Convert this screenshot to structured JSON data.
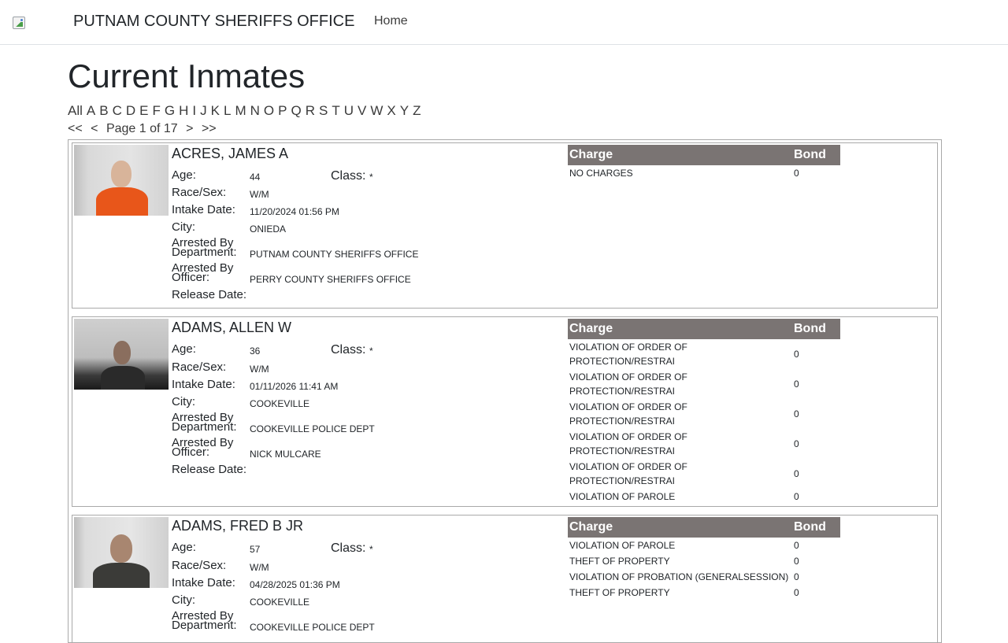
{
  "header": {
    "brand": "PUTNAM COUNTY SHERIFFS OFFICE",
    "home_label": "Home"
  },
  "page": {
    "title": "Current Inmates",
    "letters": [
      "All",
      "A",
      "B",
      "C",
      "D",
      "E",
      "F",
      "G",
      "H",
      "I",
      "J",
      "K",
      "L",
      "M",
      "N",
      "O",
      "P",
      "Q",
      "R",
      "S",
      "T",
      "U",
      "V",
      "W",
      "X",
      "Y",
      "Z"
    ],
    "pager": {
      "first": "<<",
      "prev": "<",
      "label": "Page 1 of 17",
      "next": ">",
      "last": ">>"
    }
  },
  "labels": {
    "age": "Age:",
    "class": "Class:",
    "race_sex": "Race/Sex:",
    "intake": "Intake Date:",
    "city": "City:",
    "dept_1": "Arrested By",
    "dept_2": "Department:",
    "officer_1": "Arrested By",
    "officer_2": "Officer:",
    "release": "Release Date:",
    "charge_header": "Charge",
    "bond_header": "Bond"
  },
  "inmates": [
    {
      "name": "ACRES, JAMES A",
      "age": "44",
      "class": "*",
      "race_sex": "W/M",
      "intake": "11/20/2024 01:56 PM",
      "city": "ONIEDA",
      "department": "PUTNAM COUNTY SHERIFFS OFFICE",
      "officer": "PERRY COUNTY SHERIFFS OFFICE",
      "release": "",
      "charges": [
        {
          "charge": "NO CHARGES",
          "bond": "0"
        }
      ]
    },
    {
      "name": "ADAMS, ALLEN W",
      "age": "36",
      "class": "*",
      "race_sex": "W/M",
      "intake": "01/11/2026 11:41 AM",
      "city": "COOKEVILLE",
      "department": "COOKEVILLE POLICE DEPT",
      "officer": "NICK MULCARE",
      "release": "",
      "charges": [
        {
          "charge": "VIOLATION OF ORDER OF PROTECTION/RESTRAI",
          "bond": "0"
        },
        {
          "charge": "VIOLATION OF ORDER OF PROTECTION/RESTRAI",
          "bond": "0"
        },
        {
          "charge": "VIOLATION OF ORDER OF PROTECTION/RESTRAI",
          "bond": "0"
        },
        {
          "charge": "VIOLATION OF ORDER OF PROTECTION/RESTRAI",
          "bond": "0"
        },
        {
          "charge": "VIOLATION OF ORDER OF PROTECTION/RESTRAI",
          "bond": "0"
        },
        {
          "charge": "VIOLATION OF PAROLE",
          "bond": "0"
        }
      ]
    },
    {
      "name": "ADAMS, FRED B JR",
      "age": "57",
      "class": "*",
      "race_sex": "W/M",
      "intake": "04/28/2025 01:36 PM",
      "city": "COOKEVILLE",
      "department": "COOKEVILLE POLICE DEPT",
      "officer": "",
      "release": "",
      "charges": [
        {
          "charge": "VIOLATION OF PAROLE",
          "bond": "0"
        },
        {
          "charge": "THEFT OF PROPERTY",
          "bond": "0"
        },
        {
          "charge": "VIOLATION OF PROBATION (GENERALSESSION)",
          "bond": "0"
        },
        {
          "charge": "THEFT OF PROPERTY",
          "bond": "0"
        }
      ]
    }
  ],
  "colors": {
    "table_header_bg": "#7a7473",
    "border": "#a9a9a9",
    "text": "#212529"
  }
}
